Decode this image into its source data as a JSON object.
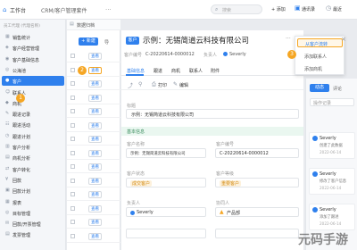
{
  "topbar": {
    "workspace": "工作台",
    "tab": "CRM/客户管理套件",
    "menu": "...",
    "search_placeholder": "搜索",
    "add": "+ 添加",
    "notify": "通讯录",
    "recent": "最近"
  },
  "sidebar": {
    "header": "员工代理 (代理名称)",
    "items": [
      "销售统计",
      "客户经营管理",
      "客户基础信息",
      "公海池",
      "客户",
      "联系人",
      "商机",
      "跟进记录",
      "跟进活动",
      "跟进计划",
      "客户分析",
      "商机分析",
      "客户转化",
      "回款",
      "回款计划",
      "报表",
      "目标管理",
      "回款/开票管理",
      "发票管理"
    ],
    "active_index": 4,
    "step1": "1"
  },
  "list": {
    "header": "数据归档",
    "add_button": "+ 新建",
    "import_button": "导",
    "badge2": "2",
    "rows": [
      "查看",
      "查看",
      "查看",
      "查看",
      "查看",
      "查看",
      "查看",
      "查看",
      "查看",
      "查看",
      "查看",
      "查看",
      "查看",
      "查看"
    ]
  },
  "detail": {
    "type_tag": "客户",
    "title": "示例：无锡简道云科技有限公司",
    "actions_dots": "···",
    "close_icon": "×",
    "meta": [
      {
        "label": "客户编号",
        "value": "C-20220614-0000012"
      },
      {
        "label": "负责人",
        "value": "Severly"
      }
    ],
    "tabs": [
      "基础信息",
      "跟进",
      "商机",
      "联系人",
      "附件"
    ],
    "active_tab": 0,
    "action_icons": [
      "share",
      "print",
      "edit"
    ],
    "print_label": "打印",
    "edit_label": "编辑",
    "title_label": "标题",
    "title_value": "示例：无锡简道云科技有限公司",
    "section": "基本信息",
    "fields": [
      {
        "label": "客户名称",
        "value": "示例：无锡简道云科技有限公司"
      },
      {
        "label": "客户编号",
        "value": "C-20220614-0000012"
      },
      {
        "label": "客户状态",
        "value": "成交客户"
      },
      {
        "label": "客户等级",
        "value": "重要客户"
      },
      {
        "label": "负责人",
        "value": "Severly"
      },
      {
        "label": "协同人",
        "value": "产品部"
      }
    ],
    "dropdown": [
      "从客户流转",
      "添加联系人",
      "添加商机"
    ],
    "step3": "3"
  },
  "right": {
    "tab_active": "动态",
    "tabs": [
      "动态",
      "评论"
    ],
    "tab_more": "操作记录",
    "feed": [
      {
        "user": "Severly",
        "text": "创建了此数据",
        "time": "2022-06-14"
      },
      {
        "user": "Severly",
        "text": "修改了客户信息",
        "time": "2022-06-14"
      },
      {
        "user": "Severly",
        "text": "添加了跟进",
        "time": "2022-06-14"
      }
    ]
  },
  "watermark": "元码手游",
  "colors": {
    "accent": "#2f80ed",
    "orange": "#f5a623",
    "green": "#3cb371"
  }
}
